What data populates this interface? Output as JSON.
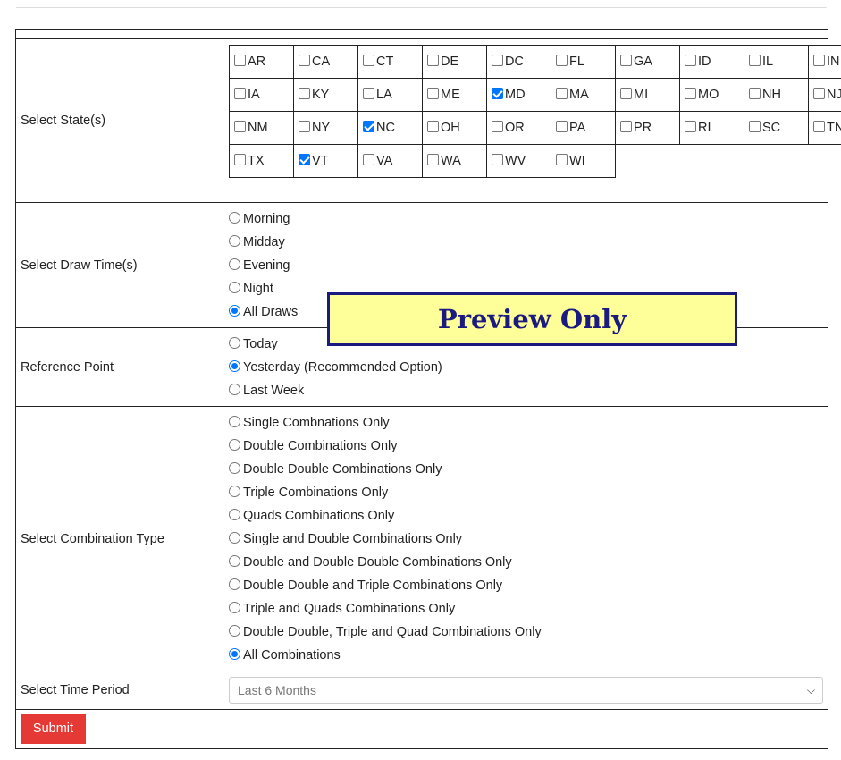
{
  "form": {
    "states_label": "Select State(s)",
    "states": [
      [
        {
          "code": "AR",
          "checked": false
        },
        {
          "code": "CA",
          "checked": false
        },
        {
          "code": "CT",
          "checked": false
        },
        {
          "code": "DE",
          "checked": false
        },
        {
          "code": "DC",
          "checked": false
        },
        {
          "code": "FL",
          "checked": false
        },
        {
          "code": "GA",
          "checked": false
        },
        {
          "code": "ID",
          "checked": false
        },
        {
          "code": "IL",
          "checked": false
        },
        {
          "code": "IN",
          "checked": false
        }
      ],
      [
        {
          "code": "IA",
          "checked": false
        },
        {
          "code": "KY",
          "checked": false
        },
        {
          "code": "LA",
          "checked": false
        },
        {
          "code": "ME",
          "checked": false
        },
        {
          "code": "MD",
          "checked": true
        },
        {
          "code": "MA",
          "checked": false
        },
        {
          "code": "MI",
          "checked": false
        },
        {
          "code": "MO",
          "checked": false
        },
        {
          "code": "NH",
          "checked": false
        },
        {
          "code": "NJ",
          "checked": false
        }
      ],
      [
        {
          "code": "NM",
          "checked": false
        },
        {
          "code": "NY",
          "checked": false
        },
        {
          "code": "NC",
          "checked": true
        },
        {
          "code": "OH",
          "checked": false
        },
        {
          "code": "OR",
          "checked": false
        },
        {
          "code": "PA",
          "checked": false
        },
        {
          "code": "PR",
          "checked": false
        },
        {
          "code": "RI",
          "checked": false
        },
        {
          "code": "SC",
          "checked": false
        },
        {
          "code": "TN",
          "checked": false
        }
      ],
      [
        {
          "code": "TX",
          "checked": false
        },
        {
          "code": "VT",
          "checked": true
        },
        {
          "code": "VA",
          "checked": false
        },
        {
          "code": "WA",
          "checked": false
        },
        {
          "code": "WV",
          "checked": false
        },
        {
          "code": "WI",
          "checked": false
        }
      ]
    ],
    "draw_time_label": "Select Draw Time(s)",
    "draw_times": [
      {
        "label": "Morning",
        "selected": false
      },
      {
        "label": "Midday",
        "selected": false
      },
      {
        "label": "Evening",
        "selected": false
      },
      {
        "label": "Night",
        "selected": false
      },
      {
        "label": "All Draws",
        "selected": true
      }
    ],
    "reference_label": "Reference Point",
    "reference_points": [
      {
        "label": "Today",
        "selected": false
      },
      {
        "label": "Yesterday (Recommended Option)",
        "selected": true
      },
      {
        "label": "Last Week",
        "selected": false
      }
    ],
    "combination_label": "Select Combination Type",
    "combinations": [
      {
        "label": "Single Combnations Only",
        "selected": false
      },
      {
        "label": "Double Combinations Only",
        "selected": false
      },
      {
        "label": "Double Double Combinations Only",
        "selected": false
      },
      {
        "label": "Triple Combinations Only",
        "selected": false
      },
      {
        "label": "Quads Combinations Only",
        "selected": false
      },
      {
        "label": "Single and Double Combinations Only",
        "selected": false
      },
      {
        "label": "Double and Double Double Combinations Only",
        "selected": false
      },
      {
        "label": "Double Double and Triple Combinations Only",
        "selected": false
      },
      {
        "label": "Triple and Quads Combinations Only",
        "selected": false
      },
      {
        "label": "Double Double, Triple and Quad Combinations Only",
        "selected": false
      },
      {
        "label": "All Combinations",
        "selected": true
      }
    ],
    "time_period_label": "Select Time Period",
    "time_period_value": "Last 6 Months",
    "submit_label": "Submit"
  },
  "banner": {
    "text": "Preview Only"
  },
  "colors": {
    "accent": "#0075ff",
    "submit": "#e53935",
    "banner_bg": "#ffff99",
    "banner_fg": "#1a1a80"
  },
  "icons": {
    "select_chevron": "chevron-down-icon"
  }
}
